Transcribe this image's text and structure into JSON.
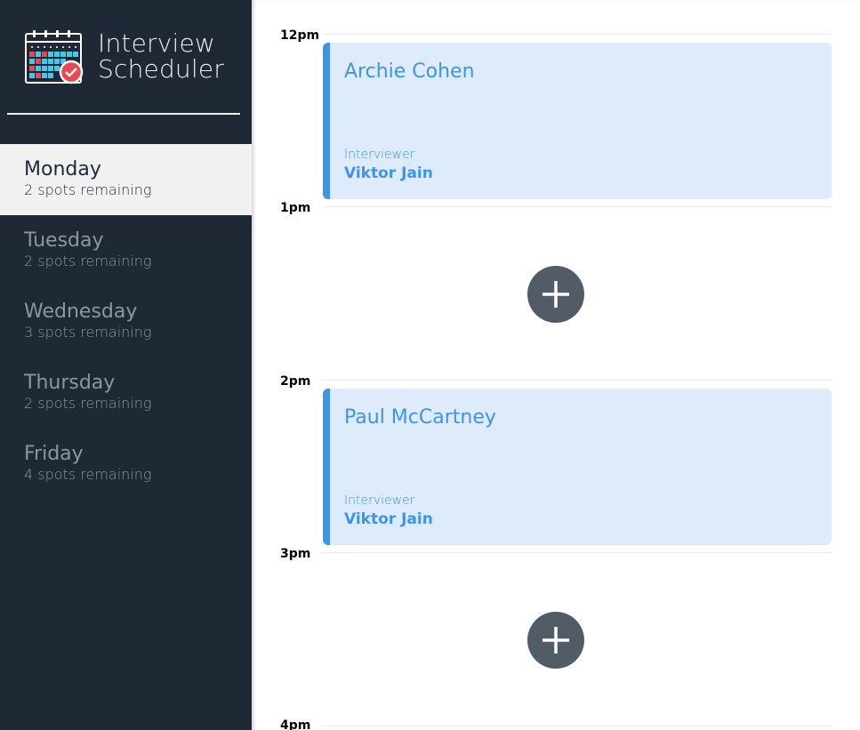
{
  "brand": {
    "line1": "Interview",
    "line2": "Scheduler",
    "icon": "calendar-check-icon"
  },
  "days": [
    {
      "name": "Monday",
      "spots": "2 spots remaining",
      "selected": true
    },
    {
      "name": "Tuesday",
      "spots": "2 spots remaining",
      "selected": false
    },
    {
      "name": "Wednesday",
      "spots": "3 spots remaining",
      "selected": false
    },
    {
      "name": "Thursday",
      "spots": "2 spots remaining",
      "selected": false
    },
    {
      "name": "Friday",
      "spots": "4 spots remaining",
      "selected": false
    }
  ],
  "slots": [
    {
      "time": "12pm"
    },
    {
      "time": "1pm"
    },
    {
      "time": "2pm"
    },
    {
      "time": "3pm"
    },
    {
      "time": "4pm"
    }
  ],
  "appointments": [
    {
      "time": "12pm",
      "student": "Archie Cohen",
      "interviewer_label": "Interviewer",
      "interviewer": "Viktor Jain"
    },
    {
      "time": "2pm",
      "student": "Paul McCartney",
      "interviewer_label": "Interviewer",
      "interviewer": "Viktor Jain"
    }
  ],
  "add_buttons": [
    {
      "time": "1pm",
      "icon": "plus-icon"
    },
    {
      "time": "3pm",
      "icon": "plus-icon"
    }
  ],
  "colors": {
    "sidebar_bg": "#1f2935",
    "selected_bg": "#f1f1f1",
    "accent_blue": "#3d94e8",
    "appointment_bg": "#deebfb",
    "add_button_bg": "#525c67"
  }
}
